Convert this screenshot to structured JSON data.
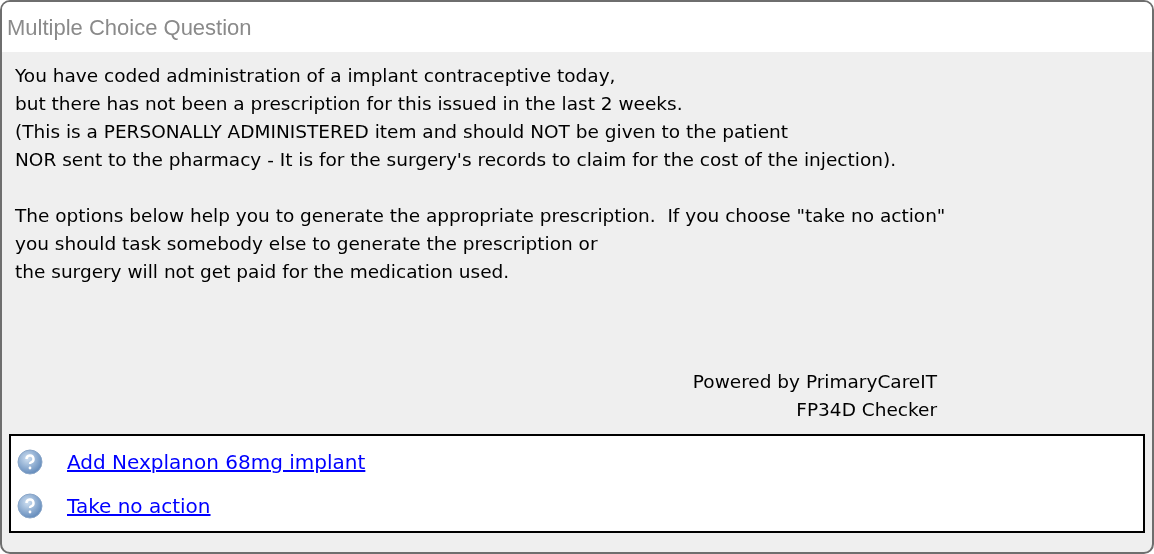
{
  "window": {
    "title": "Multiple Choice Question"
  },
  "message": [
    [
      "You have coded administration of a implant contraceptive today,",
      "but there has not been a prescription for this issued in the last 2 weeks.",
      "(This is a PERSONALLY ADMINISTERED item and should NOT be given to the patient",
      "NOR sent to the pharmacy - It is for the surgery's records to claim for the cost of the injection)."
    ],
    [
      "The options below help you to generate the appropriate prescription.  If you choose \"take no action\"",
      "you should task somebody else to generate the prescription or",
      "the surgery will not get paid for the medication used."
    ]
  ],
  "credits": [
    "Powered by PrimaryCareIT",
    "FP34D Checker"
  ],
  "options": [
    {
      "label": "Add Nexplanon 68mg implant"
    },
    {
      "label": "Take no action"
    }
  ]
}
